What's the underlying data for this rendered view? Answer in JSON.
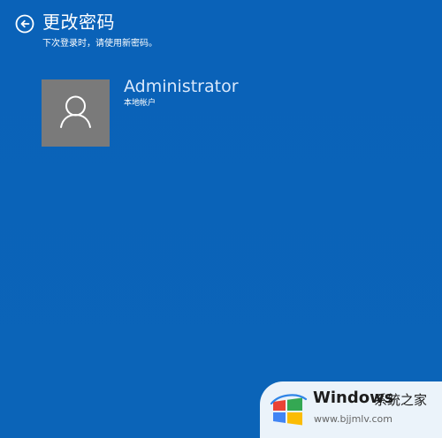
{
  "header": {
    "title": "更改密码",
    "subtitle": "下次登录时，请使用新密码。"
  },
  "user": {
    "name": "Administrator",
    "account_type": "本地帐户"
  },
  "icons": {
    "back": "back-arrow-icon",
    "avatar": "user-avatar-icon",
    "windows_logo": "windows-logo-icon"
  },
  "watermark": {
    "brand": "Windows",
    "brand_cn": "系统之家",
    "url": "www.bjjmlv.com"
  },
  "colors": {
    "background": "#0b64b8",
    "avatar_bg": "#7a7a7a",
    "text": "#ffffff"
  }
}
